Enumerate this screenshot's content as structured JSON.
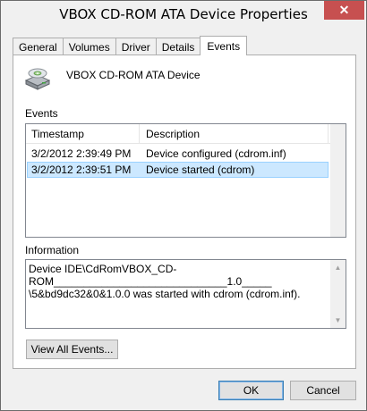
{
  "window": {
    "title": "VBOX CD-ROM ATA Device Properties",
    "close_glyph": "✕"
  },
  "tabs": [
    {
      "label": "General"
    },
    {
      "label": "Volumes"
    },
    {
      "label": "Driver"
    },
    {
      "label": "Details"
    },
    {
      "label": "Events",
      "active": true
    }
  ],
  "device": {
    "name": "VBOX CD-ROM ATA Device",
    "icon": "cdrom-drive-icon"
  },
  "events": {
    "label": "Events",
    "columns": [
      "Timestamp",
      "Description"
    ],
    "rows": [
      {
        "timestamp": "3/2/2012 2:39:49 PM",
        "description": "Device configured (cdrom.inf)"
      },
      {
        "timestamp": "3/2/2012 2:39:51 PM",
        "description": "Device started (cdrom)",
        "selected": true
      }
    ]
  },
  "information": {
    "label": "Information",
    "line1": "Device IDE\\CdRomVBOX_CD-",
    "line2": "ROM_____________________________1.0_____",
    "line3": "\\5&bd9dc32&0&1.0.0 was started with cdrom (cdrom.inf)."
  },
  "buttons": {
    "view_all": "View All Events...",
    "ok": "OK",
    "cancel": "Cancel"
  },
  "colors": {
    "close_button": "#c75050",
    "selection": "#cce8ff"
  }
}
